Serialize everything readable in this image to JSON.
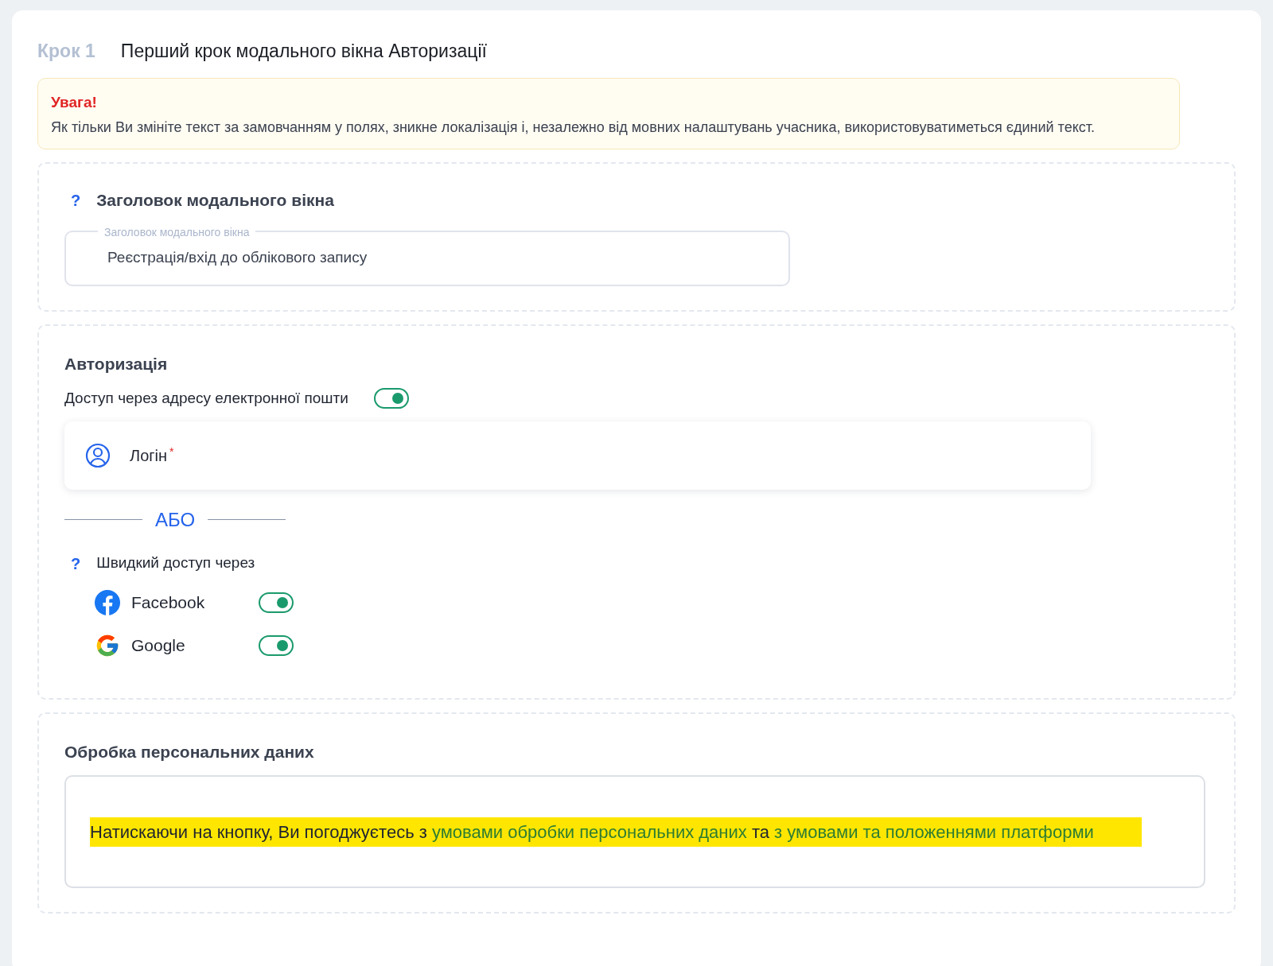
{
  "header": {
    "step": "Крок 1",
    "title": "Перший крок модального вікна Авторизації"
  },
  "notice": {
    "heading": "Увага!",
    "text": "Як тільки Ви змініте текст за замовчанням у полях, зникне локалізація і, незалежно від мовних налаштувань учасника, використовуватиметься єдиний текст."
  },
  "title_section": {
    "help": "?",
    "heading": "Заголовок модального вікна",
    "field": {
      "label": "Заголовок модального вікна",
      "value": "Реєстрація/вхід до облікового запису"
    }
  },
  "auth_section": {
    "heading": "Авторизація",
    "email_access": {
      "label": "Доступ через адресу електронної пошти",
      "on": true
    },
    "login_field": {
      "label": "Логін",
      "required_mark": "*"
    },
    "divider": "АБО",
    "quick_access": {
      "help": "?",
      "label": "Швидкий доступ через"
    },
    "providers": [
      {
        "kind": "facebook",
        "label": "Facebook",
        "on": true
      },
      {
        "kind": "google",
        "label": "Google",
        "on": true
      }
    ]
  },
  "privacy_section": {
    "heading": "Обробка персональних даних",
    "text_parts": [
      {
        "kind": "text",
        "text": "Натискаючи на кнопку, Ви погоджуєтесь з "
      },
      {
        "kind": "link",
        "text": "умовами обробки персональних даних"
      },
      {
        "kind": "text",
        "text": " та "
      },
      {
        "kind": "link",
        "text": "з умовами та положеннями платформи"
      }
    ],
    "highlighted": true
  }
}
